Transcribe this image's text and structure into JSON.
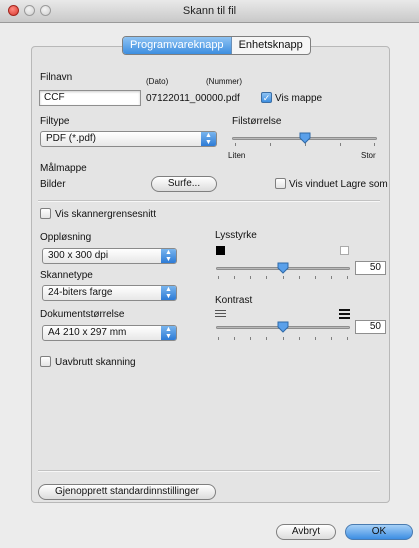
{
  "window": {
    "title": "Skann til fil"
  },
  "tabs": [
    {
      "label": "Programvareknapp"
    },
    {
      "label": "Enhetsknapp"
    }
  ],
  "file": {
    "filename_label": "Filnavn",
    "date_label": "(Dato)",
    "number_label": "(Nummer)",
    "filename_value": "CCF",
    "generated_name": "07122011_00000.pdf",
    "show_folder_label": "Vis mappe",
    "show_folder_checked": true
  },
  "filetype": {
    "label": "Filtype",
    "value": "PDF (*.pdf)"
  },
  "filesize": {
    "label": "Filstørrelse",
    "min_label": "Liten",
    "max_label": "Stor",
    "level": 0.4
  },
  "target": {
    "label": "Målmappe",
    "folder_value": "Bilder",
    "browse_label": "Surfe...",
    "save_as_label": "Vis vinduet Lagre som",
    "save_as_checked": false
  },
  "scanner_ui": {
    "label": "Vis skannergrensesnitt",
    "checked": false
  },
  "resolution": {
    "label": "Oppløsning",
    "value": "300 x 300 dpi"
  },
  "scan_type": {
    "label": "Skannetype",
    "value": "24-biters farge"
  },
  "document_size": {
    "label": "Dokumentstørrelse",
    "value": "A4 210 x 297 mm"
  },
  "continuous": {
    "label": "Uavbrutt skanning",
    "checked": false
  },
  "brightness": {
    "label": "Lysstyrke",
    "value": "50"
  },
  "contrast": {
    "label": "Kontrast",
    "value": "50"
  },
  "buttons": {
    "restore_label": "Gjenopprett standardinnstillinger",
    "cancel_label": "Avbryt",
    "ok_label": "OK"
  },
  "icons": {
    "close": "close-icon",
    "minimize": "minimize-icon",
    "zoom": "zoom-icon",
    "popup": "popup-arrows-icon",
    "check": "checkmark-icon",
    "brightness_low": "brightness-low-icon",
    "brightness_high": "brightness-high-icon",
    "contrast_low": "contrast-low-icon",
    "contrast_high": "contrast-high-icon",
    "slider_thumb": "slider-thumb-icon"
  },
  "colors": {
    "accent": "#3d8ee0",
    "window_bg": "#ececec"
  }
}
